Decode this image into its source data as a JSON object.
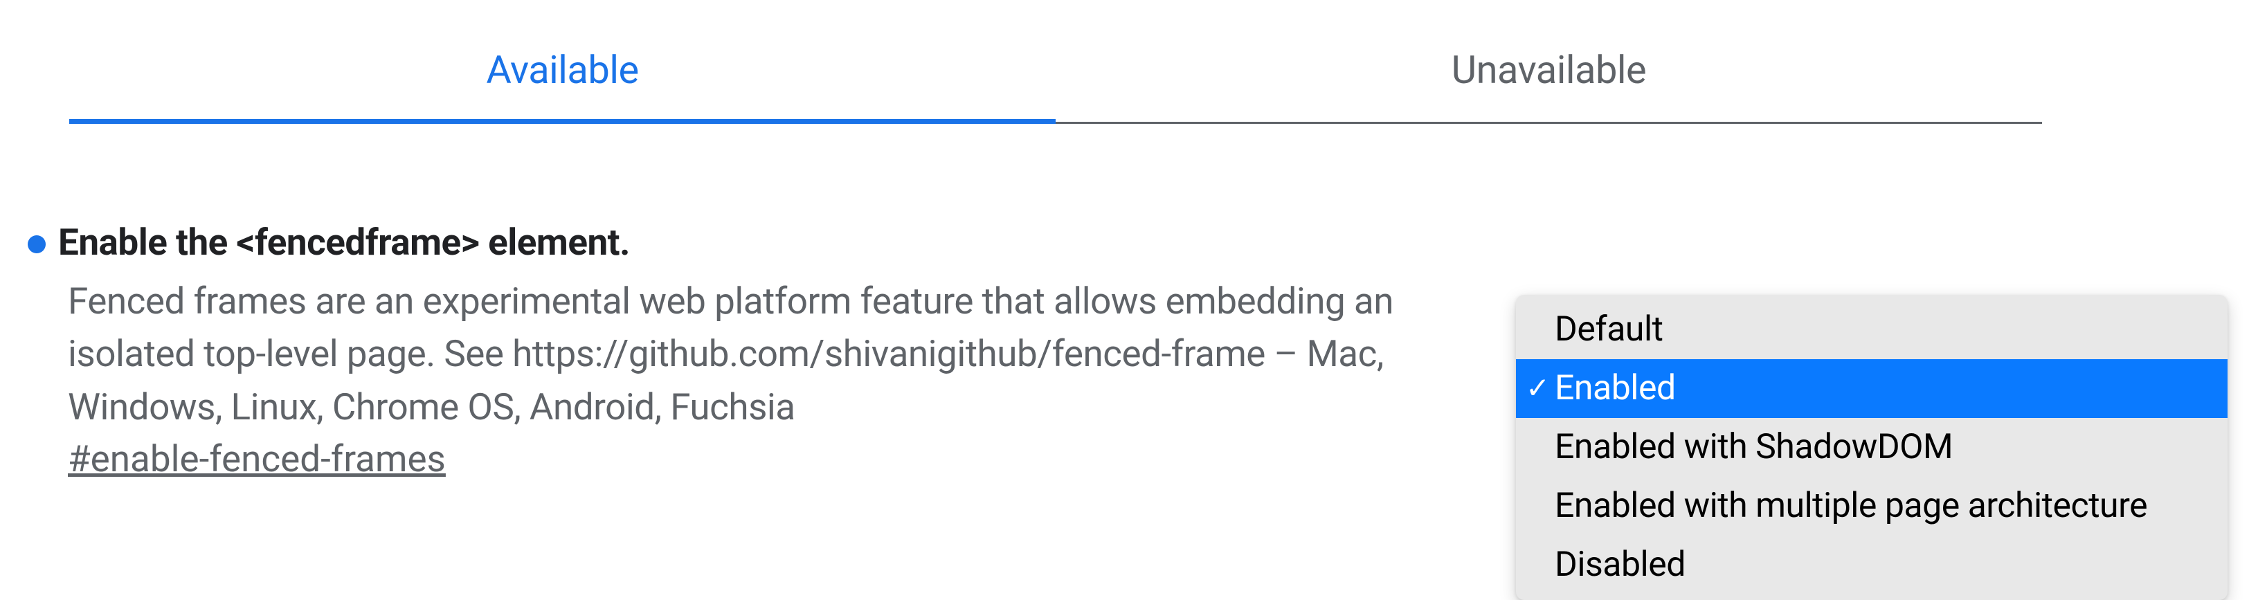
{
  "tabs": {
    "active": "Available",
    "inactive": "Unavailable"
  },
  "flag": {
    "title": "Enable the <fencedframe> element.",
    "description": "Fenced frames are an experimental web platform feature that allows embedding an isolated top-level page. See https://github.com/shivanigithub/fenced-frame – Mac, Windows, Linux, Chrome OS, Android, Fuchsia",
    "link": "#enable-fenced-frames"
  },
  "dropdown": {
    "options": [
      "Default",
      "Enabled",
      "Enabled with ShadowDOM",
      "Enabled with multiple page architecture",
      "Disabled"
    ],
    "selected_index": 1,
    "checkmark": "✓"
  },
  "colors": {
    "accent": "#1a73e8",
    "text_primary": "#202124",
    "text_secondary": "#5f6368",
    "menu_bg": "#e8e8e8",
    "menu_selected": "#0a7aff"
  }
}
